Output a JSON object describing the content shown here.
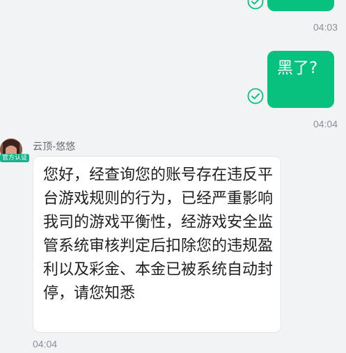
{
  "chat": {
    "messages": [
      {
        "direction": "sent",
        "text": "",
        "time": "04:03",
        "status": "delivered-check-icon"
      },
      {
        "direction": "sent",
        "text": "黑了?",
        "time": "04:04",
        "status": "delivered-check-icon"
      },
      {
        "direction": "received",
        "sender": "云顶-悠悠",
        "badge": "官方认证",
        "text": "您好，经查询您的账号存在违反平台游戏规则的行为，已经严重影响我司的游戏平衡性，经游戏安全监管系统审核判定后扣除您的违规盈利以及彩金、本金已被系统自动封停，请您知悉",
        "time": "04:04"
      }
    ]
  },
  "colors": {
    "background": "#f2f3f5",
    "sent_bubble": "#07c27f",
    "received_bubble": "#ffffff",
    "check_icon": "#07c27f",
    "badge": "#14b38a",
    "timestamp": "#8a8f99"
  }
}
